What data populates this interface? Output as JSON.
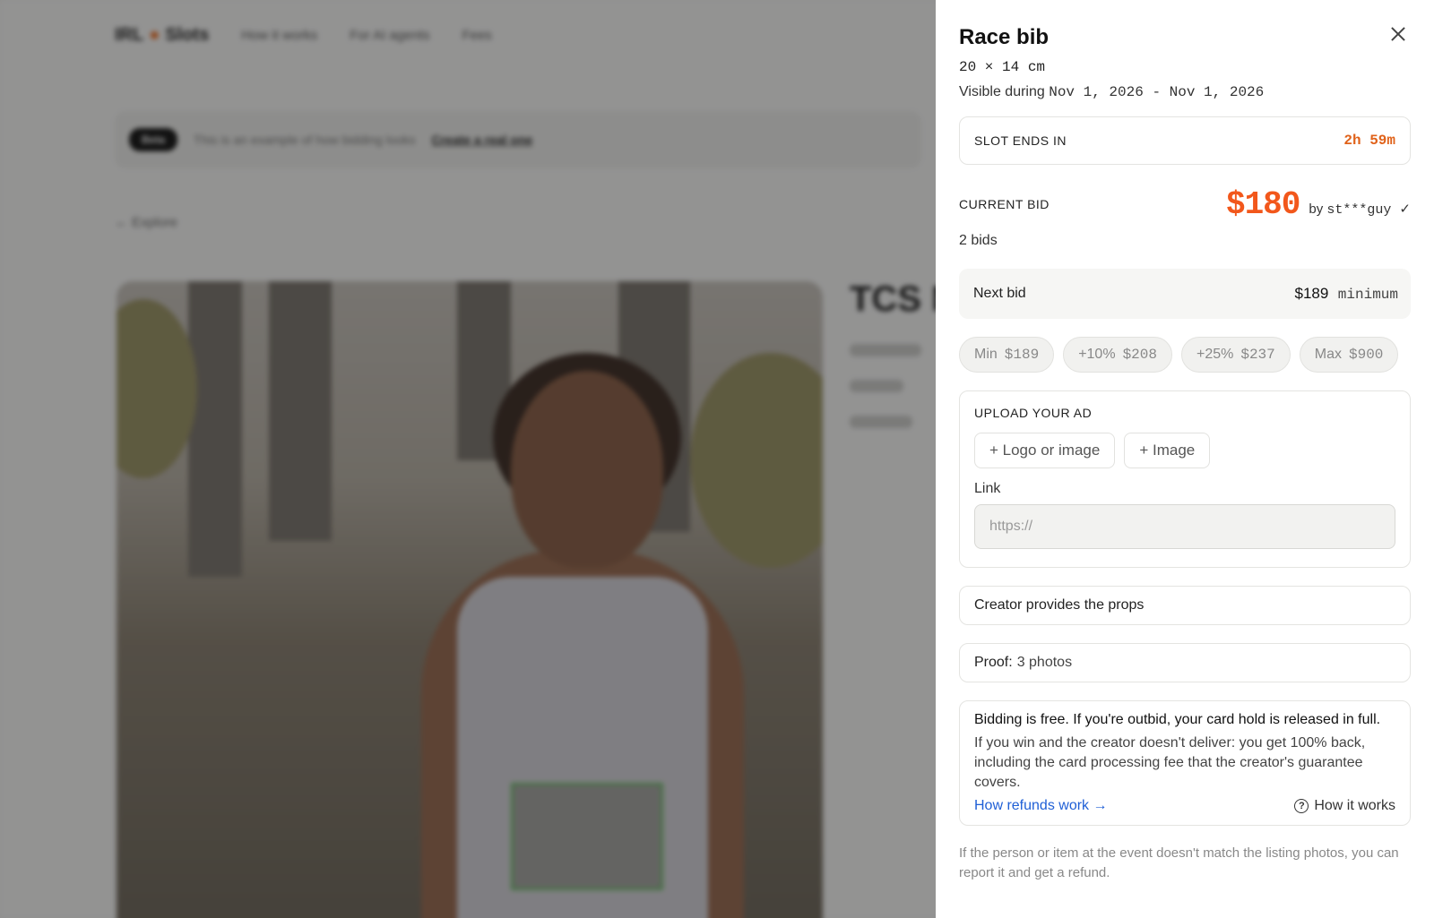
{
  "background": {
    "logo_left": "IRL",
    "logo_right": "Slots",
    "nav": [
      "How it works",
      "For AI agents",
      "Fees"
    ],
    "banner_pill": "Beta",
    "banner_text": "This is an example of how bidding looks",
    "banner_link": "Create a real one",
    "back_link": "← Explore",
    "event_title": "TCS Mar"
  },
  "drawer": {
    "title": "Race bib",
    "dimensions": "20 × 14 cm",
    "visible_prefix": "Visible during",
    "visible_dates": "Nov 1, 2026 - Nov 1, 2026",
    "slot_label": "SLOT ENDS IN",
    "slot_time": "2h 59m",
    "current_bid_label": "CURRENT BID",
    "current_bid_amount": "$180",
    "bid_by_prefix": "by",
    "bid_by_user": "st***guy ✓",
    "bid_count": "2 bids",
    "next_bid_label": "Next bid",
    "next_bid_value": "$189",
    "next_bid_suffix": "minimum",
    "chips": [
      {
        "label": "Min",
        "value": "$189"
      },
      {
        "label": "+10%",
        "value": "$208"
      },
      {
        "label": "+25%",
        "value": "$237"
      },
      {
        "label": "Max",
        "value": "$900"
      }
    ],
    "upload_label": "UPLOAD YOUR AD",
    "upload_logo_button": "+ Logo or image",
    "upload_image_button": "+ Image",
    "link_label": "Link",
    "link_placeholder": "https://",
    "props_text": "Creator provides the props",
    "proof_label": "Proof:",
    "proof_value": "3 photos",
    "info_strong": "Bidding is free. If you're outbid, your card hold is released in full.",
    "info_body": "If you win and the creator doesn't deliver: you get 100% back, including the card processing fee that the creator's guarantee covers.",
    "refund_link": "How refunds work →",
    "how_it_works": "How it works",
    "report_text": "If the person or item at the event doesn't match the listing photos, you can report it and get a refund."
  },
  "colors": {
    "accent": "#f2571b",
    "timer": "#e0621a",
    "link": "#1f5fd6"
  }
}
